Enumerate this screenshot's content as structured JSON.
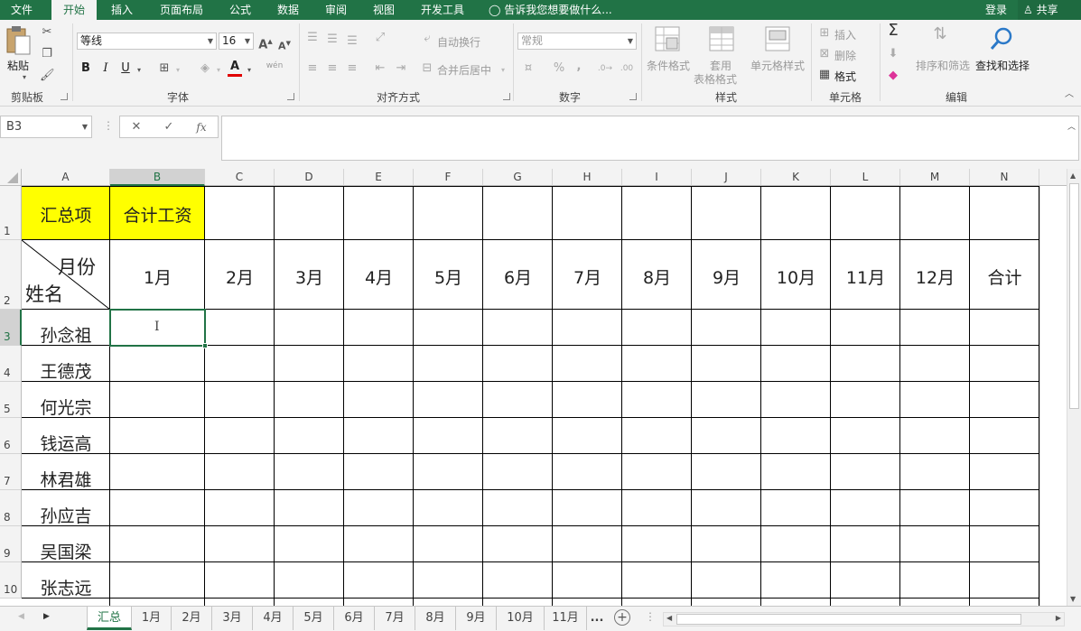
{
  "ribbon_tabs": [
    "文件",
    "开始",
    "插入",
    "页面布局",
    "公式",
    "数据",
    "审阅",
    "视图",
    "开发工具"
  ],
  "active_tab": "开始",
  "tell_me": "告诉我您想要做什么...",
  "login": "登录",
  "share": "共享",
  "clipboard": {
    "paste": "粘贴",
    "group": "剪贴板"
  },
  "font": {
    "name": "等线",
    "size": "16",
    "bold": "B",
    "italic": "I",
    "underline": "U",
    "color_letter": "A",
    "wen": "wén",
    "group": "字体"
  },
  "alignment": {
    "wrap": "自动换行",
    "merge": "合并后居中",
    "group": "对齐方式"
  },
  "number": {
    "format": "常规",
    "percent": "%",
    "comma": ",",
    "group": "数字"
  },
  "styles": {
    "conditional": "条件格式",
    "table_format": "套用\n表格格式",
    "table_format_line1": "套用",
    "table_format_line2": "表格格式",
    "cell_styles": "单元格样式",
    "group": "样式"
  },
  "cells": {
    "insert": "插入",
    "delete": "删除",
    "format": "格式",
    "group": "单元格"
  },
  "editing": {
    "sort": "排序和筛选",
    "find": "查找和选择",
    "group": "编辑"
  },
  "formula_bar": {
    "name_box": "B3",
    "fx": "fx",
    "value": ""
  },
  "columns": [
    "A",
    "B",
    "C",
    "D",
    "E",
    "F",
    "G",
    "H",
    "I",
    "J",
    "K",
    "L",
    "M",
    "N"
  ],
  "rows": [
    "1",
    "2",
    "3",
    "4",
    "5",
    "6",
    "7",
    "8",
    "9",
    "10"
  ],
  "selected_cell": "B3",
  "sheet": {
    "a1": "汇总项",
    "b1": "合计工资",
    "a2_top": "月份",
    "a2_bottom": "姓名",
    "months": [
      "1月",
      "2月",
      "3月",
      "4月",
      "5月",
      "6月",
      "7月",
      "8月",
      "9月",
      "10月",
      "11月",
      "12月",
      "合计"
    ],
    "names": [
      "孙念祖",
      "王德茂",
      "何光宗",
      "钱运高",
      "林君雄",
      "孙应吉",
      "吴国梁",
      "张志远"
    ],
    "highlight_color": "#ffff00"
  },
  "sheet_tabs": [
    "汇总",
    "1月",
    "2月",
    "3月",
    "4月",
    "5月",
    "6月",
    "7月",
    "8月",
    "9月",
    "10月",
    "11月",
    "..."
  ],
  "active_sheet": "汇总",
  "colors": {
    "accent": "#217346",
    "ribbon_bg": "#f3f3f3",
    "header_bg": "#f3f3f3"
  }
}
